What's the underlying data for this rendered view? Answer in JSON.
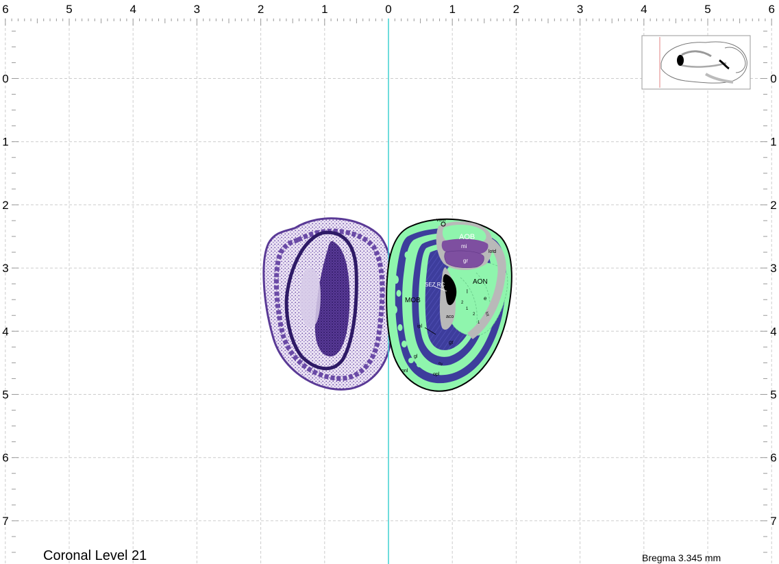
{
  "figure": {
    "level_title": "Coronal Level 21",
    "bregma": "Bregma 3.345 mm"
  },
  "axes": {
    "top_ticks": [
      "6",
      "5",
      "4",
      "3",
      "2",
      "1",
      "0",
      "1",
      "2",
      "3",
      "4",
      "5",
      "6"
    ],
    "side_ticks": [
      "0",
      "1",
      "2",
      "3",
      "4",
      "5",
      "6",
      "7"
    ]
  },
  "regions": {
    "vom": "vom",
    "aob": "AOB",
    "mi": "mi",
    "gr_upper": "gr",
    "lotd": "lotd",
    "sez_rc": "SEZ RC",
    "aon": "AON",
    "l": "l",
    "e": "e",
    "mob": "MOB",
    "n2a": "2",
    "n1a": "1",
    "n2b": "2",
    "n1b": "1",
    "aco": "aco",
    "lot": "lot",
    "ipl": "ipl",
    "gr_lower": "gr",
    "gl": "gl",
    "mi_lower": "mi",
    "onl": "onl",
    "opl": "opl"
  },
  "colors": {
    "grid": "#cccccc",
    "midline": "#3fd0d0",
    "tissue_green": "#8ff5ad",
    "layer_blue": "#3d3d9c",
    "layer_purple": "#7e4fa0",
    "fiber_gray": "#b9b9b9",
    "nissl_purple": "#4a2a86"
  }
}
